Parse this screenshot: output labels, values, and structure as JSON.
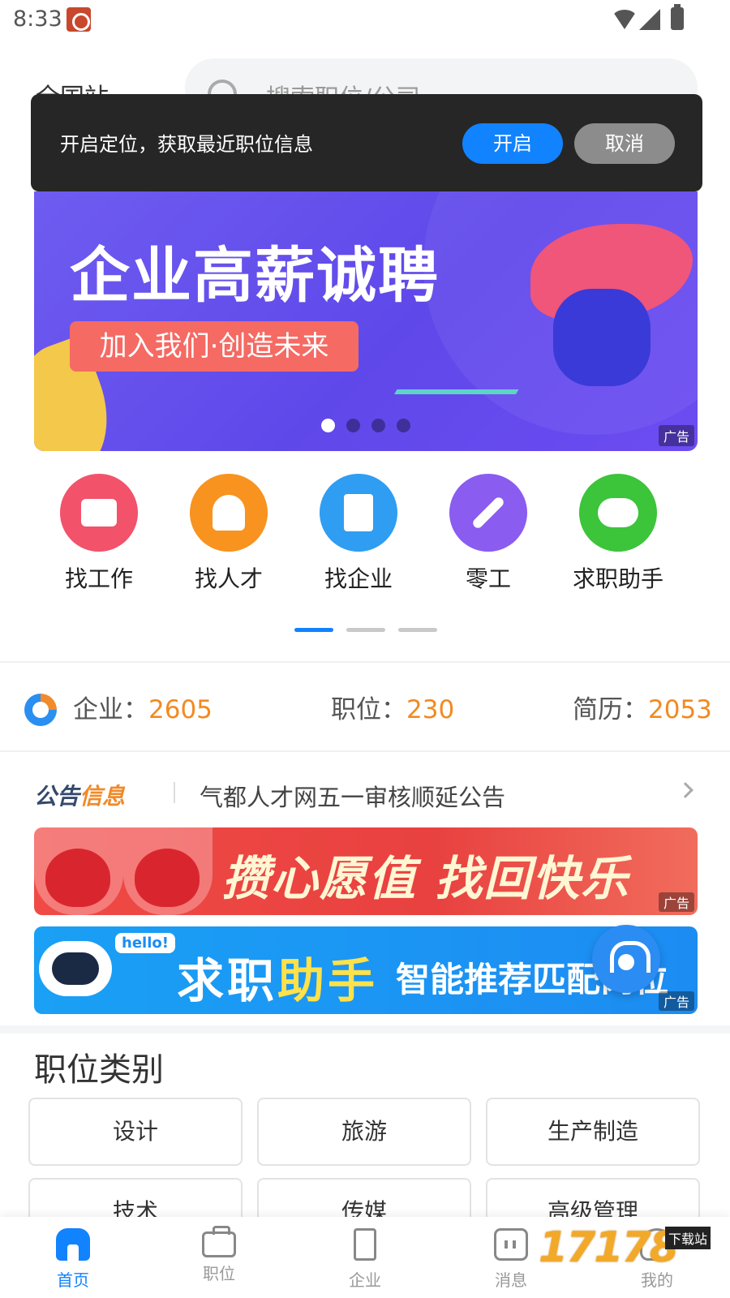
{
  "status_bar": {
    "time": "8:33"
  },
  "header": {
    "city": "全国站",
    "search_placeholder": "搜索职位/公司"
  },
  "location_popup": {
    "message": "开启定位，获取最近职位信息",
    "confirm_label": "开启",
    "cancel_label": "取消"
  },
  "main_banner": {
    "title": "企业高薪诚聘",
    "subtitle": "加入我们·创造未来",
    "ad_tag": "广告",
    "active_slide": 1,
    "slide_count": 4
  },
  "quick_menu": {
    "items": [
      {
        "label": "找工作",
        "icon": "briefcase-icon",
        "color": "#f2526a"
      },
      {
        "label": "找人才",
        "icon": "person-icon",
        "color": "#f7931e"
      },
      {
        "label": "找企业",
        "icon": "building-icon",
        "color": "#2f9df2"
      },
      {
        "label": "零工",
        "icon": "wrench-icon",
        "color": "#8a5cf0"
      },
      {
        "label": "求职助手",
        "icon": "robot-icon",
        "color": "#3cc43a"
      }
    ],
    "active_page": 1,
    "page_count": 3
  },
  "stats": {
    "enterprise_label": "企业：",
    "enterprise_value": "2605",
    "position_label": "职位：",
    "position_value": "230",
    "resume_label": "简历：",
    "resume_value": "2053"
  },
  "notice": {
    "logo_part1": "公告",
    "logo_part2": "信息",
    "text": "气都人才网五一审核顺延公告"
  },
  "ad_red": {
    "slogan": "攒心愿值 找回快乐",
    "ad_tag": "广告"
  },
  "ad_blue": {
    "slogan_part1": "求职",
    "slogan_part2": "助手",
    "slogan_sub": "智能推荐匹配岗位",
    "hello": "hello!",
    "ad_tag": "广告"
  },
  "categories": {
    "title": "职位类别",
    "items": [
      "设计",
      "旅游",
      "生产制造",
      "技术",
      "传媒",
      "高级管理"
    ]
  },
  "bottom_nav": {
    "items": [
      {
        "label": "首页",
        "icon": "home-icon",
        "active": true
      },
      {
        "label": "职位",
        "icon": "briefcase-icon",
        "active": false
      },
      {
        "label": "企业",
        "icon": "building-icon",
        "active": false
      },
      {
        "label": "消息",
        "icon": "message-icon",
        "active": false
      },
      {
        "label": "我的",
        "icon": "profile-icon",
        "active": false
      }
    ]
  },
  "watermark": {
    "text": "17178",
    "tag": "下载站"
  },
  "colors": {
    "accent": "#1183ff",
    "stat_value": "#f28a20",
    "popup_bg": "#262626"
  }
}
